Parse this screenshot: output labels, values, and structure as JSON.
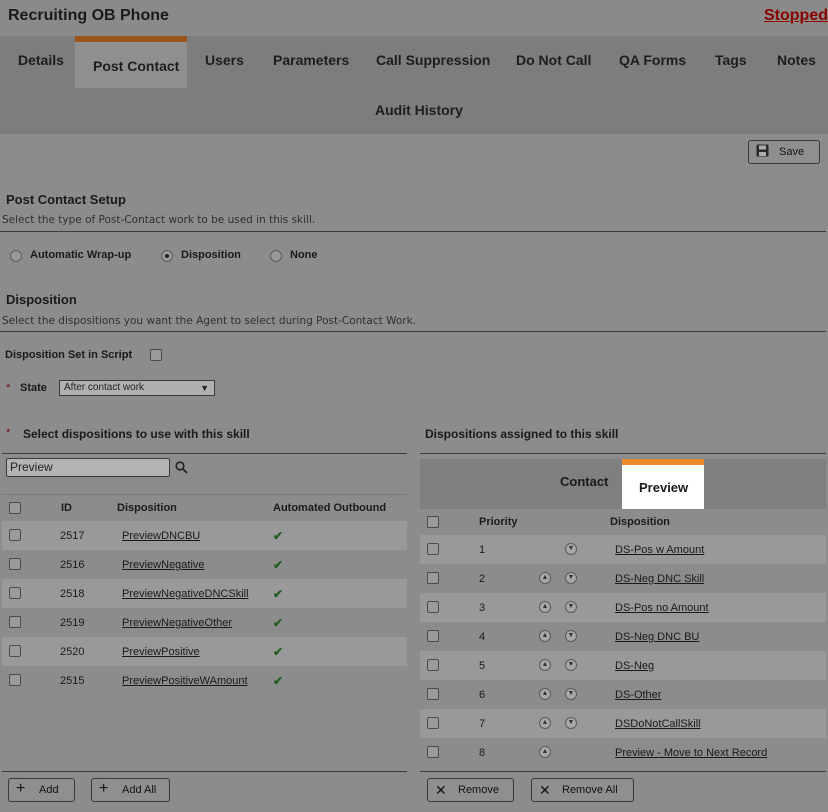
{
  "header": {
    "title": "Recruiting OB Phone",
    "status": "Stopped"
  },
  "tabs": {
    "details": "Details",
    "post_contact": "Post Contact",
    "users": "Users",
    "parameters": "Parameters",
    "call_suppression": "Call Suppression",
    "do_not_call": "Do Not Call",
    "qa_forms": "QA Forms",
    "tags": "Tags",
    "notes": "Notes",
    "audit_history": "Audit History"
  },
  "toolbar": {
    "save_label": "Save"
  },
  "post_contact_setup": {
    "title": "Post Contact Setup",
    "description": "Select the type of Post-Contact work to be used in this skill.",
    "options": {
      "automatic_wrapup": "Automatic Wrap-up",
      "disposition": "Disposition",
      "none": "None"
    },
    "selected": "Disposition"
  },
  "disposition_section": {
    "title": "Disposition",
    "description": "Select the dispositions you want the Agent to select during Post-Contact Work.",
    "set_in_script_label": "Disposition Set in Script",
    "state_label": "State",
    "state_value": "After contact work",
    "required_mark": "*"
  },
  "available": {
    "title": "Select dispositions to use with this skill",
    "search_value": "Preview",
    "columns": {
      "id": "ID",
      "disposition": "Disposition",
      "automated": "Automated Outbound"
    },
    "rows": [
      {
        "id": "2517",
        "name": "PreviewDNCBU",
        "automated": "✔"
      },
      {
        "id": "2516",
        "name": "PreviewNegative",
        "automated": "✔"
      },
      {
        "id": "2518",
        "name": "PreviewNegativeDNCSkill",
        "automated": "✔"
      },
      {
        "id": "2519",
        "name": "PreviewNegativeOther",
        "automated": "✔"
      },
      {
        "id": "2520",
        "name": "PreviewPositive",
        "automated": "✔"
      },
      {
        "id": "2515",
        "name": "PreviewPositiveWAmount",
        "automated": "✔"
      }
    ],
    "add_label": "Add",
    "add_all_label": "Add All"
  },
  "assigned": {
    "title": "Dispositions assigned to this skill",
    "subtabs": {
      "contact": "Contact",
      "preview": "Preview"
    },
    "columns": {
      "priority": "Priority",
      "disposition": "Disposition"
    },
    "rows": [
      {
        "priority": "1",
        "name": "DS-Pos w Amount"
      },
      {
        "priority": "2",
        "name": "DS-Neg DNC Skill"
      },
      {
        "priority": "3",
        "name": "DS-Pos no Amount"
      },
      {
        "priority": "4",
        "name": "DS-Neg DNC BU"
      },
      {
        "priority": "5",
        "name": "DS-Neg"
      },
      {
        "priority": "6",
        "name": "DS-Other"
      },
      {
        "priority": "7",
        "name": "DSDoNotCallSkill"
      },
      {
        "priority": "8",
        "name": "Preview - Move to Next Record"
      }
    ],
    "remove_label": "Remove",
    "remove_all_label": "Remove All"
  }
}
